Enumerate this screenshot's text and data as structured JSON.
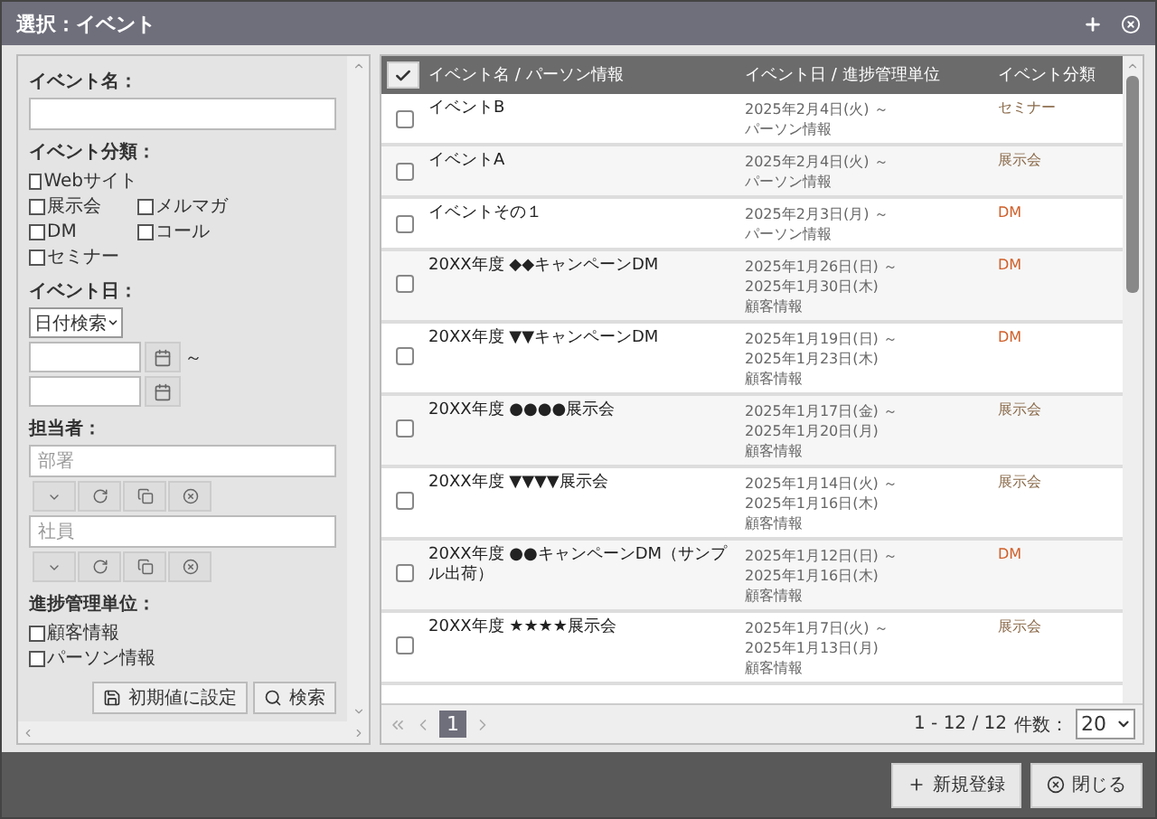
{
  "window": {
    "title": "選択：イベント"
  },
  "search_panel": {
    "event_name": {
      "label": "イベント名："
    },
    "event_category": {
      "label": "イベント分類：",
      "option_rows": [
        [
          {
            "label": "Webサイト",
            "checked": false
          }
        ],
        [
          {
            "label": "展示会",
            "checked": false
          },
          {
            "label": "メルマガ",
            "checked": false
          }
        ],
        [
          {
            "label": "DM",
            "checked": false
          },
          {
            "label": "コール",
            "checked": false
          }
        ],
        [
          {
            "label": "セミナー",
            "checked": false
          }
        ]
      ]
    },
    "event_date": {
      "label": "イベント日：",
      "mode": "日付検索",
      "separator": "～"
    },
    "person": {
      "label": "担当者：",
      "fields": [
        {
          "placeholder": "部署"
        },
        {
          "placeholder": "社員"
        }
      ]
    },
    "progress_unit": {
      "label": "進捗管理単位：",
      "options": [
        {
          "label": "顧客情報",
          "checked": false
        },
        {
          "label": "パーソン情報",
          "checked": false
        }
      ]
    },
    "buttons": [
      "初期値に設定",
      "検索"
    ]
  },
  "table": {
    "select_all": {
      "checked": true
    },
    "columns": [
      "イベント名 / パーソン情報",
      "イベント日 / 進捗管理単位",
      "イベント分類"
    ],
    "rows": [
      {
        "checked": false,
        "name": "イベントB",
        "details": [
          "2025年2月4日(火) ～",
          "パーソン情報"
        ],
        "category": "セミナー",
        "color": "#8a6a4a"
      },
      {
        "checked": false,
        "name": "イベントA",
        "details": [
          "2025年2月4日(火) ～",
          "パーソン情報"
        ],
        "category": "展示会",
        "color": "#8a6a4a"
      },
      {
        "checked": false,
        "name": "イベントその１",
        "details": [
          "2025年2月3日(月) ～",
          "パーソン情報"
        ],
        "category": "DM",
        "color": "#d0602a"
      },
      {
        "checked": false,
        "name": "20XX年度 ◆◆キャンペーンDM",
        "details": [
          "2025年1月26日(日) ～",
          "2025年1月30日(木)",
          "顧客情報"
        ],
        "category": "DM",
        "color": "#d0602a"
      },
      {
        "checked": false,
        "name": "20XX年度 ▼▼キャンペーンDM",
        "details": [
          "2025年1月19日(日) ～",
          "2025年1月23日(木)",
          "顧客情報"
        ],
        "category": "DM",
        "color": "#d0602a"
      },
      {
        "checked": false,
        "name": "20XX年度 ●●●●展示会",
        "details": [
          "2025年1月17日(金) ～",
          "2025年1月20日(月)",
          "顧客情報"
        ],
        "category": "展示会",
        "color": "#8a6a4a"
      },
      {
        "checked": false,
        "name": "20XX年度 ▼▼▼▼展示会",
        "details": [
          "2025年1月14日(火) ～",
          "2025年1月16日(木)",
          "顧客情報"
        ],
        "category": "展示会",
        "color": "#8a6a4a"
      },
      {
        "checked": false,
        "name": "20XX年度 ●●キャンペーンDM（サンプル出荷）",
        "details": [
          "2025年1月12日(日) ～",
          "2025年1月16日(木)",
          "顧客情報"
        ],
        "category": "DM",
        "color": "#d0602a"
      },
      {
        "checked": false,
        "name": "20XX年度 ★★★★展示会",
        "details": [
          "2025年1月7日(火) ～",
          "2025年1月13日(月)",
          "顧客情報"
        ],
        "category": "展示会",
        "color": "#8a6a4a"
      }
    ]
  },
  "pagination": {
    "pages": [
      {
        "label": "1",
        "selected": true
      }
    ],
    "summary": "1 - 12 / 12",
    "page_size_label": "件数：",
    "page_size": "20"
  },
  "footer_buttons": [
    "新規登録",
    "閉じる"
  ]
}
